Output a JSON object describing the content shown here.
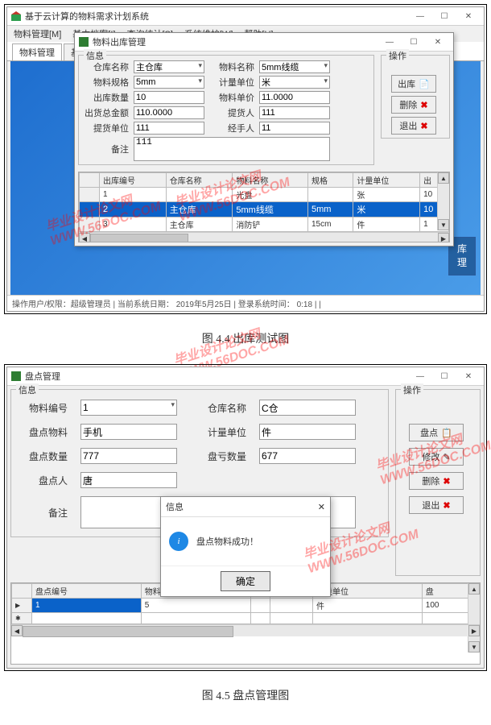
{
  "fig1": {
    "mainWindow": {
      "title": "基于云计算的物料需求计划系统",
      "menu": [
        "物料管理[M]",
        "基本档案[I]",
        "查询统计[S]",
        "系统维护[W]",
        "帮助[H]"
      ],
      "tabs": [
        "物料管理",
        "基"
      ],
      "sideBtn": "库\n理",
      "status": "操作用户/权限：超级管理员  |  当前系统日期：  2019年5月25日  |  登录系统时间：  0:18  |  |"
    },
    "dialog": {
      "title": "物料出库管理",
      "infoLabel": "信息",
      "opsLabel": "操作",
      "fields": {
        "warehouseName_lbl": "仓库名称",
        "warehouseName_val": "主仓库",
        "materialName_lbl": "物料名称",
        "materialName_val": "5mm线缆",
        "spec_lbl": "物料规格",
        "spec_val": "5mm",
        "unit_lbl": "计量单位",
        "unit_val": "米",
        "outQty_lbl": "出库数量",
        "outQty_val": "10",
        "unitPrice_lbl": "物料单价",
        "unitPrice_val": "11.0000",
        "total_lbl": "出货总金额",
        "total_val": "110.0000",
        "receiver_lbl": "提货人",
        "receiver_val": "111",
        "receiverUnit_lbl": "提货单位",
        "receiverUnit_val": "111",
        "handler_lbl": "经手人",
        "handler_val": "11",
        "remark_lbl": "备注",
        "remark_val": "111"
      },
      "ops": {
        "out": "出库",
        "delete": "删除",
        "exit": "退出"
      },
      "table": {
        "headers": [
          "",
          "出库编号",
          "仓库名称",
          "物料名称",
          "规格",
          "计量单位",
          "出"
        ],
        "rows": [
          [
            "",
            "1",
            "",
            "光盘",
            "",
            "张",
            "10"
          ],
          [
            "",
            "2",
            "主仓库",
            "5mm线缆",
            "5mm",
            "米",
            "10"
          ],
          [
            "",
            "3",
            "主仓库",
            "消防铲",
            "15cm",
            "件",
            "1"
          ]
        ],
        "selected": 1
      }
    },
    "caption": "图 4.4  出库测试图",
    "watermark": "毕业设计论文网\nWWW.56DOC.COM"
  },
  "fig2": {
    "dialog": {
      "title": "盘点管理",
      "infoLabel": "信息",
      "opsLabel": "操作",
      "fields": {
        "matNo_lbl": "物料编号",
        "matNo_val": "1",
        "whName_lbl": "仓库名称",
        "whName_val": "C仓",
        "matName_lbl": "盘点物料",
        "matName_val": "手机",
        "unit_lbl": "计量单位",
        "unit_val": "件",
        "qty_lbl": "盘点数量",
        "qty_val": "777",
        "diff_lbl": "盘亏数量",
        "diff_val": "677",
        "person_lbl": "盘点人",
        "person_val": "唐",
        "remark_lbl": "备注",
        "remark_val": ""
      },
      "ops": {
        "check": "盘点",
        "edit": "修改",
        "delete": "删除",
        "exit": "退出"
      },
      "table": {
        "headers": [
          "",
          "盘点编号",
          "物料编号",
          "",
          "称",
          "计量单位",
          "盘"
        ],
        "rows": [
          [
            "▶",
            "1",
            "5",
            "",
            "",
            "件",
            "100"
          ],
          [
            "*",
            "",
            "",
            "",
            "",
            "",
            ""
          ]
        ],
        "selected": 0
      },
      "msg": {
        "title": "信息",
        "text": "盘点物料成功！",
        "ok": "确定"
      }
    },
    "caption": "图 4.5  盘点管理图",
    "watermark": "毕业设计论文网\nWWW.56DOC.COM"
  }
}
